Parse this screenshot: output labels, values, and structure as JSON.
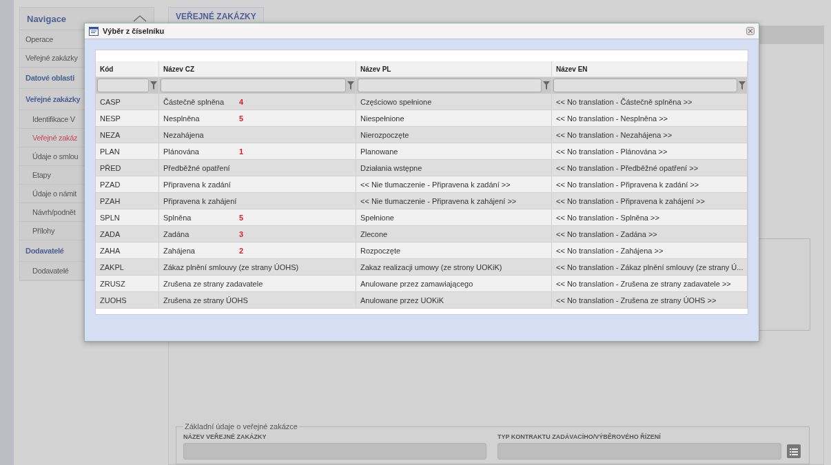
{
  "sidebar": {
    "title": "Navigace",
    "expanded": true,
    "items": [
      {
        "label": "Operace",
        "kind": "link",
        "selected": false
      },
      {
        "label": "Veřejné zakázky",
        "kind": "link",
        "selected": false
      },
      {
        "label": "Datové oblasti",
        "kind": "heading",
        "selected": false
      },
      {
        "label": "Veřejné zakázky",
        "kind": "heading",
        "selected": false,
        "children": [
          {
            "label": "Identifikace V",
            "selected": false
          },
          {
            "label": "Veřejné zakáz",
            "selected": true
          },
          {
            "label": "Údaje o smlou",
            "selected": false
          },
          {
            "label": "Etapy",
            "selected": false
          },
          {
            "label": "Údaje o námit",
            "selected": false
          },
          {
            "label": "Návrh/podnět",
            "selected": false
          },
          {
            "label": "Přílohy",
            "selected": false
          }
        ]
      },
      {
        "label": "Dodavatelé",
        "kind": "heading",
        "selected": false,
        "children": [
          {
            "label": "Dodavatelé",
            "selected": false
          }
        ]
      }
    ]
  },
  "main": {
    "tab": "VEŘEJNÉ ZAKÁZKY",
    "fieldset": {
      "legend": "Základní údaje o veřejné zakázce",
      "fields": [
        {
          "label": "NÁZEV VEŘEJNÉ ZAKÁZKY",
          "kind": "text"
        },
        {
          "label": "TYP KONTRAKTU ZADÁVACÍHO/VÝBĚROVÉHO ŘÍZENÍ",
          "kind": "picker"
        }
      ]
    }
  },
  "dialog": {
    "title": "Výběr z číselníku",
    "columns": [
      "Kód",
      "Název CZ",
      "Název PL",
      "Název EN"
    ],
    "rows": [
      {
        "code": "CASP",
        "cz": "Částečně splněna",
        "note": "4",
        "pl": "Częściowo spełnione",
        "en": "<< No translation - Částečně splněna >>"
      },
      {
        "code": "NESP",
        "cz": "Nesplněna",
        "note": "5",
        "pl": "Niespełnione",
        "en": "<< No translation - Nesplněna >>"
      },
      {
        "code": "NEZA",
        "cz": "Nezahájena",
        "pl": "Nierozpoczęte",
        "en": "<< No translation - Nezahájena >>"
      },
      {
        "code": "PLAN",
        "cz": "Plánována",
        "note": "1",
        "pl": "Planowane",
        "en": "<< No translation - Plánována >>"
      },
      {
        "code": "PŘED",
        "cz": "Předběžné opatření",
        "pl": "Działania wstępne",
        "en": "<< No translation - Předběžné opatření >>"
      },
      {
        "code": "PZAD",
        "cz": "Připravena k zadání",
        "pl": "<< Nie tlumaczenie - Připravena k zadání >>",
        "en": "<< No translation - Připravena k zadání >>"
      },
      {
        "code": "PZAH",
        "cz": "Připravena k zahájení",
        "pl": "<< Nie tlumaczenie - Připravena k zahájení >>",
        "en": "<< No translation - Připravena k zahájení >>"
      },
      {
        "code": "SPLN",
        "cz": "Splněna",
        "note": "5",
        "pl": "Spełnione",
        "en": "<< No translation - Splněna >>"
      },
      {
        "code": "ZADA",
        "cz": "Zadána",
        "note": "3",
        "pl": "Zlecone",
        "en": "<< No translation - Zadána >>"
      },
      {
        "code": "ZAHA",
        "cz": "Zahájena",
        "note": "2",
        "pl": "Rozpoczęte",
        "en": "<< No translation - Zahájena >>"
      },
      {
        "code": "ZAKPL",
        "cz": "Zákaz plnění smlouvy (ze strany ÚOHS)",
        "pl": "Zakaz realizacji umowy (ze strony UOKiK)",
        "en": "<< No translation - Zákaz plnění smlouvy (ze strany Ú..."
      },
      {
        "code": "ZRUSZ",
        "cz": "Zrušena ze strany zadavatele",
        "pl": "Anulowane przez zamawiającego",
        "en": "<< No translation - Zrušena ze strany zadavatele >>"
      },
      {
        "code": "ZUOHS",
        "cz": "Zrušena ze strany ÚOHS",
        "pl": "Anulowane przez UOKiK",
        "en": "<< No translation - Zrušena ze strany ÚOHS >>"
      }
    ]
  }
}
